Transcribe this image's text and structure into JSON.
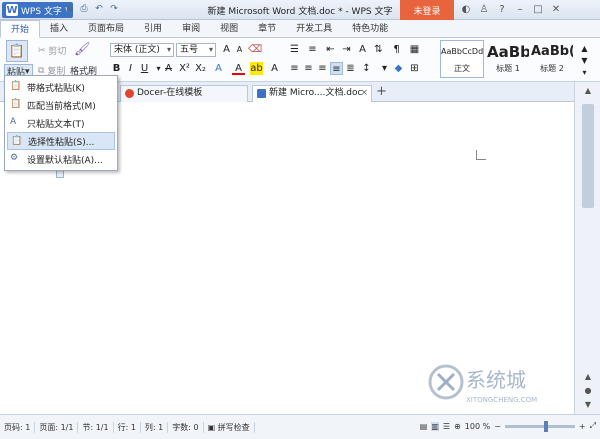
{
  "titlebar": {
    "app_button": "WPS 文字",
    "app_letter": "W",
    "title": "新建 Microsoft Word 文档.doc * - WPS 文字",
    "login": "未登录"
  },
  "ribbon_tabs": [
    "开始",
    "插入",
    "页面布局",
    "引用",
    "审阅",
    "视图",
    "章节",
    "开发工具",
    "特色功能"
  ],
  "clipboard": {
    "paste": "粘贴",
    "cut": "剪切",
    "copy": "复制",
    "format_painter": "格式刷"
  },
  "font": {
    "name": "宋体 (正文)",
    "size": "五号"
  },
  "styles": [
    {
      "sample": "AaBbCcDd",
      "label": "正文"
    },
    {
      "sample": "AaBb",
      "label": "标题 1"
    },
    {
      "sample": "AaBb(",
      "label": "标题 2"
    }
  ],
  "doc_tabs": [
    {
      "label": "Docer-在线模板",
      "color": "#e0462d"
    },
    {
      "label": "新建 Micro....文档.doc *",
      "color": "#3c73c5"
    }
  ],
  "paste_menu": [
    {
      "label": "带格式粘贴(K)"
    },
    {
      "label": "匹配当前格式(M)"
    },
    {
      "label": "只粘贴文本(T)"
    },
    {
      "label": "选择性粘贴(S)..."
    },
    {
      "label": "设置默认粘贴(A)..."
    }
  ],
  "status": {
    "page_code": "页码: 1",
    "page": "页面: 1/1",
    "section": "节: 1/1",
    "row": "行: 1",
    "col": "列: 1",
    "words": "字数: 0",
    "spell": "拼写检查",
    "zoom": "100 %",
    "zoom_level_pct": 100
  },
  "watermark": {
    "main": "系统城",
    "sub": "XITONGCHENG.COM"
  }
}
